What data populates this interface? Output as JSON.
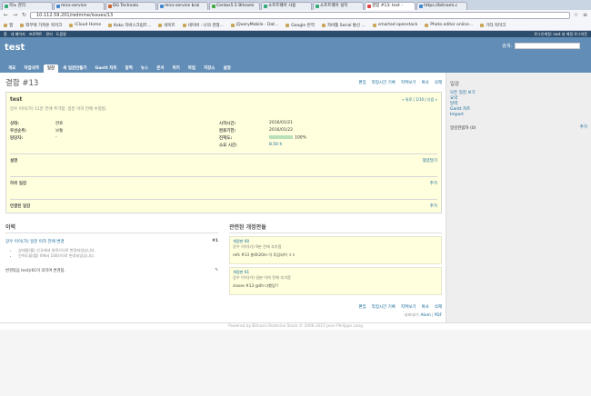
{
  "browser": {
    "tabs": [
      "목노 관리",
      "mics-service",
      "DG Technolo",
      "mics-service brai",
      "Centos5.5 Bitnami",
      "소프트웨어 사용",
      "소프트웨어 설치",
      "결함 #13: test -",
      "https://bitnami.c"
    ],
    "url": "10.112.59.201/redmine/issues/13",
    "bookmarks": [
      "앱",
      "외부에 가져온 북마크",
      "iCloud Home",
      "Koko 자바스크립트...",
      "네이트",
      "네이버 : 나의 경쟁...",
      "jQueryMobile - Dat...",
      "Google 번역",
      "자바툴 Serial 통신 ...",
      "smartad openstack",
      "Photo editor online...",
      "기타 북마크"
    ]
  },
  "top_menu": {
    "left": [
      "홈",
      "내 페이지",
      "프로젝트",
      "관리",
      "도움말"
    ],
    "right": "로그인계정: root  내 계정  로그아웃"
  },
  "project": {
    "name": "test",
    "search_label": "검색:"
  },
  "tabs": [
    "개요",
    "작업내역",
    "일감",
    "새 일감만들기",
    "Gantt 차트",
    "달력",
    "뉴스",
    "문서",
    "위키",
    "파일",
    "저장소",
    "설정"
  ],
  "issue": {
    "heading": "결함 #13",
    "actions": [
      "편집",
      "작업시간 기록",
      "지켜보기",
      "복사",
      "삭제"
    ],
    "subject": "test",
    "author_line": "강우 이이(가) 11분 전에 추가함. 일분 이하 전에 수정됨.",
    "pager": "« 뒤로 | 1/10 | 다음 »",
    "fields": [
      {
        "label": "상태:",
        "value": "완료",
        "label2": "시작시간:",
        "value2": "2016/01/21"
      },
      {
        "label": "우선순위:",
        "value": "보통",
        "label2": "완료기한:",
        "value2": "2016/01/22"
      },
      {
        "label": "담당자:",
        "value": "-",
        "label2": "진척도:",
        "value2": "100%"
      },
      {
        "label": "",
        "value": "",
        "label2": "소요 시간:",
        "value2": "8.50 h"
      }
    ],
    "progress": 1.0,
    "description_label": "설명",
    "quote_label": "댓글달기",
    "subtasks_label": "하위 일감",
    "related_label": "연결된 일감",
    "add_label": "추가"
  },
  "history": {
    "title": "이력",
    "journal_header": "강우 이이(가) 일분 이하 전에 변경",
    "journal_num": "#1",
    "changes": [
      "상태을(를) 신규에서 완료(으)로 변경되었습니다.",
      "진척도을(를) 0에서 100(으)로 변경되었습니다."
    ],
    "note": "변경묶음 test|r61이 의하여 변경됨."
  },
  "changesets": {
    "title": "관련된 개정판들",
    "items": [
      {
        "rev": "개정판 60",
        "by": "강우 이이(가) 9분 전에 추가함",
        "msg": "refs #13 총4h20m 이 투입되어 ㅎㅎ"
      },
      {
        "rev": "개정판 61",
        "by": "강우 이이(가) 일분 이하 전에 추가함",
        "msg": "closes #13 @4h 다했당!!"
      }
    ]
  },
  "export": {
    "label": "내보내기:",
    "atom": "Atom",
    "pdf": "PDF"
  },
  "sidebar": {
    "issues_title": "일감",
    "links": [
      "모든 일감 보기",
      "요약",
      "달력",
      "Gantt 차트",
      "Import"
    ],
    "watchers": "일감관람자 (0)",
    "watch_add": "추가"
  },
  "footer": "Powered by Bitnami Redmine Stack © 2006-2015 Jean-Philippe Lang"
}
